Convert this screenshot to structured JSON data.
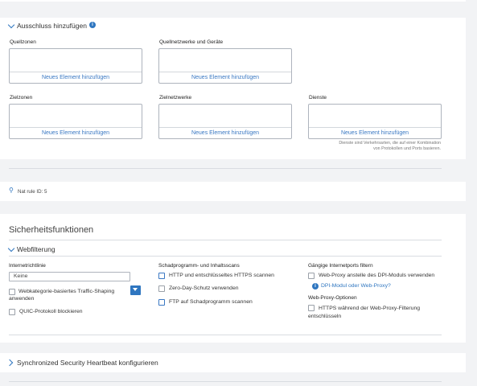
{
  "exclusion": {
    "title": "Ausschluss hinzufügen",
    "fields": [
      {
        "label": "Quellzonen",
        "add": "Neues Element hinzufügen"
      },
      {
        "label": "Quellnetzwerke und Geräte",
        "add": "Neues Element hinzufügen"
      },
      {
        "label": "Zielzonen",
        "add": "Neues Element hinzufügen"
      },
      {
        "label": "Zielnetzwerke",
        "add": "Neues Element hinzufügen"
      },
      {
        "label": "Dienste",
        "add": "Neues Element hinzufügen"
      }
    ],
    "services_hint_line1": "Dienste sind Verkehrsarten, die auf einer Kombination",
    "services_hint_line2": "von Protokollen und Ports basieren."
  },
  "nat_rule": {
    "text": "Nat rule ID: 5"
  },
  "security": {
    "heading": "Sicherheitsfunktionen",
    "web_filtering": {
      "title": "Webfilterung",
      "col1": {
        "label": "Internetrichtlinie",
        "policy_value": "Keine",
        "traffic_shaping_line1": "Webkategorie-basiertes Traffic-Shaping",
        "traffic_shaping_line2": "anwenden",
        "quic": "QUIC-Protokoll blockieren"
      },
      "col2": {
        "label": "Schadprogramm- und Inhaltsscans",
        "https_scan": "HTTP und entschlüsseltes HTTPS scannen",
        "zero_day": "Zero-Day-Schutz verwenden",
        "ftp": "FTP auf Schadprogramm scannen"
      },
      "col3": {
        "label": "Gängige Internetports filtern",
        "web_proxy": "Web-Proxy anstelle des DPI-Moduls verwenden",
        "dpi_link": "DPI-Modul oder Web-Proxy?",
        "proxy_options_label": "Web-Proxy-Optionen",
        "decrypt_line1": "HTTPS während der Web-Proxy-Filterung",
        "decrypt_line2": "entschlüsseln"
      }
    }
  },
  "heartbeat": {
    "title": "Synchronized Security Heartbeat konfigurieren"
  },
  "colors": {
    "accent": "#2f76c0",
    "link": "#3a78c3",
    "border": "#aeb4bd"
  }
}
